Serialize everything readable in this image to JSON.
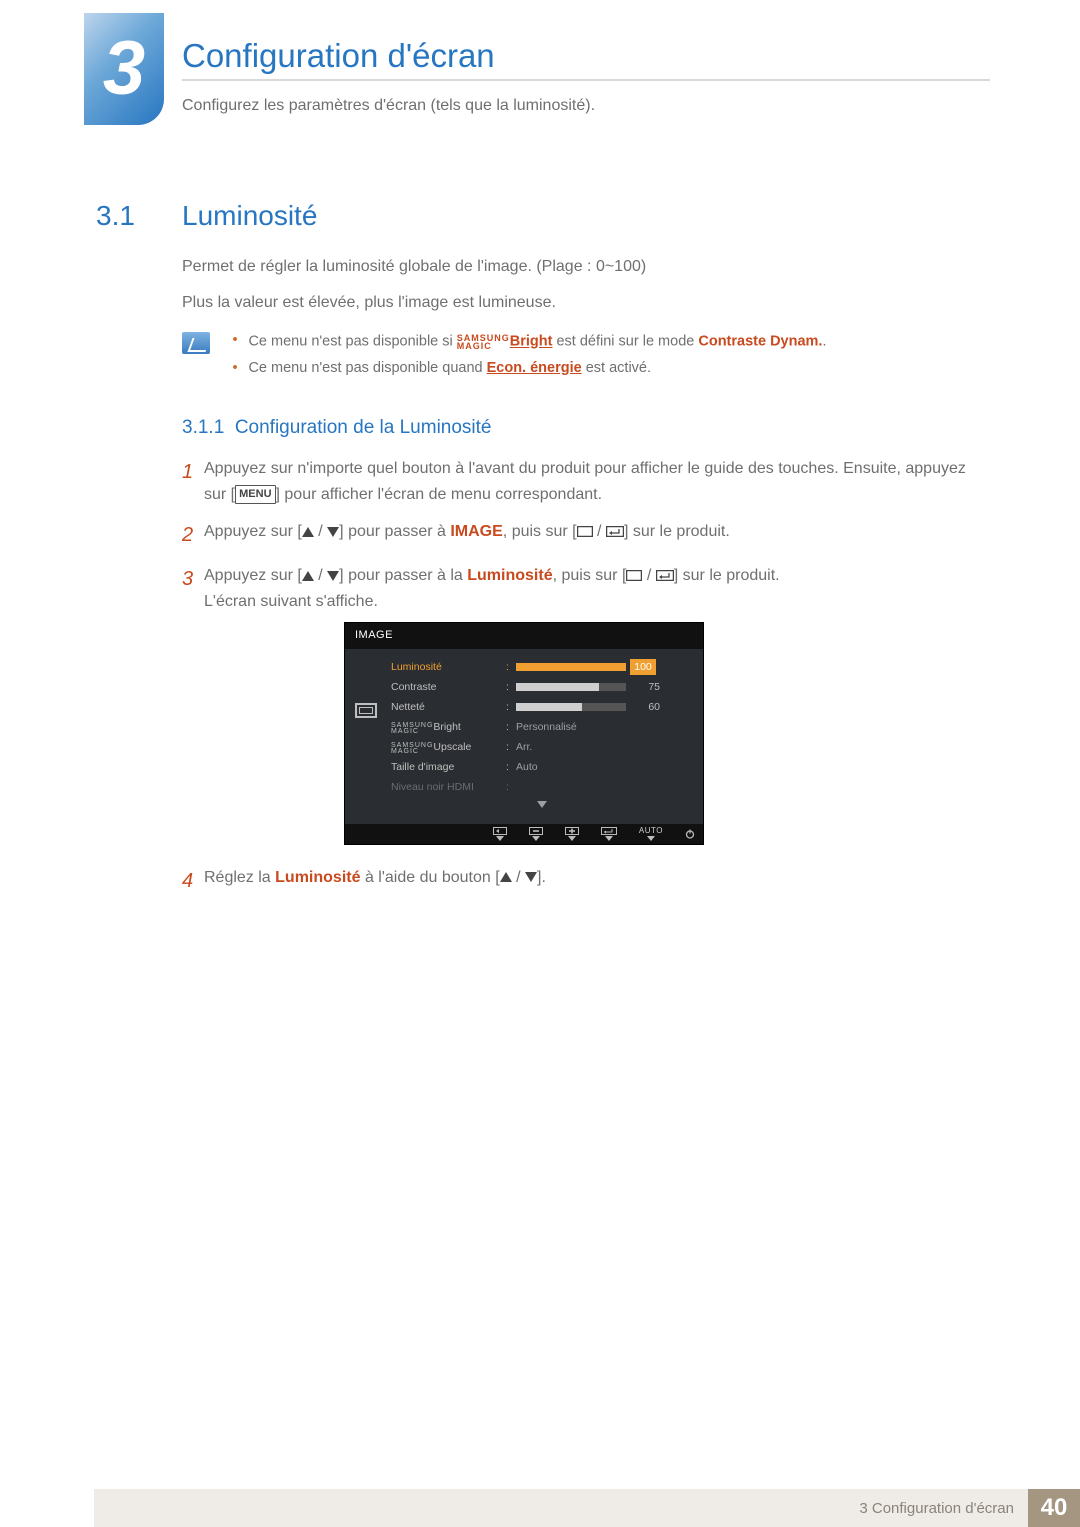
{
  "chapter": {
    "badge": "3",
    "title": "Configuration d'écran",
    "subtitle": "Configurez les paramètres d'écran (tels que la luminosité)."
  },
  "section": {
    "num": "3.1",
    "title": "Luminosité"
  },
  "paras": {
    "p1": "Permet de régler la luminosité globale de l'image. (Plage : 0~100)",
    "p2": "Plus la valeur est élevée, plus l'image est lumineuse."
  },
  "notes": {
    "n1_a": "Ce menu n'est pas disponible si ",
    "n1_brand_top": "SAMSUNG",
    "n1_brand_bot": "MAGIC",
    "n1_bright": "Bright",
    "n1_b": " est défini sur le mode ",
    "n1_c": "Contraste Dynam.",
    "n1_d": ".",
    "n2_a": "Ce menu n'est pas disponible quand ",
    "n2_b": "Econ. énergie",
    "n2_c": " est activé."
  },
  "subsection": {
    "num": "3.1.1",
    "title": "Configuration de la Luminosité"
  },
  "steps": {
    "s1_a": "Appuyez sur n'importe quel bouton à l'avant du produit pour afficher le guide des touches. Ensuite, appuyez sur [",
    "s1_menu": "MENU",
    "s1_b": "] pour afficher l'écran de menu correspondant.",
    "s2_a": "Appuyez sur [",
    "s2_b": "] pour passer à ",
    "s2_c": "IMAGE",
    "s2_d": ", puis sur [",
    "s2_e": "] sur le produit.",
    "s3_a": "Appuyez sur [",
    "s3_b": "] pour passer à la ",
    "s3_c": "Luminosité",
    "s3_d": ", puis sur [",
    "s3_e": "] sur le produit.",
    "s3_f": "L'écran suivant s'affiche.",
    "s4_a": "Réglez la ",
    "s4_b": "Luminosité",
    "s4_c": " à l'aide du bouton [",
    "s4_d": "]."
  },
  "osd": {
    "title": "IMAGE",
    "rows": {
      "luminosite": {
        "label": "Luminosité",
        "value": "100",
        "pct": 100
      },
      "contraste": {
        "label": "Contraste",
        "value": "75",
        "pct": 75
      },
      "nettete": {
        "label": "Netteté",
        "value": "60",
        "pct": 60
      },
      "magicbright": {
        "brand_top": "SAMSUNG",
        "brand_bot": "MAGIC",
        "suffix": "Bright",
        "value": "Personnalisé"
      },
      "magicupscale": {
        "brand_top": "SAMSUNG",
        "brand_bot": "MAGIC",
        "suffix": "Upscale",
        "value": "Arr."
      },
      "taille": {
        "label": "Taille d'image",
        "value": "Auto"
      },
      "hdmi": {
        "label": "Niveau noir HDMI"
      }
    },
    "footer_auto": "AUTO"
  },
  "footer": {
    "text": "3 Configuration d'écran",
    "page": "40"
  }
}
